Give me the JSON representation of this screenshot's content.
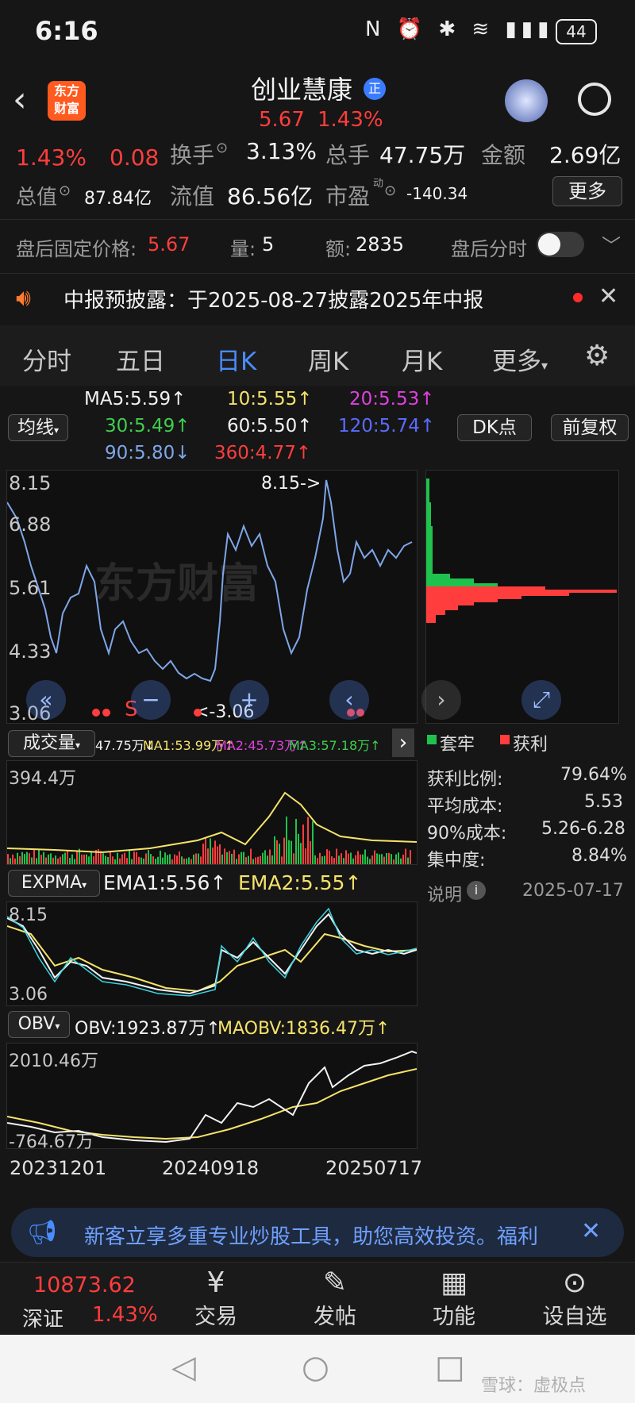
{
  "status_bar": {
    "time": "6:16",
    "battery": "44"
  },
  "header": {
    "title": "创业慧康",
    "badge": "正",
    "price": "5.67",
    "change_pct": "1.43%",
    "logo_line1": "东方",
    "logo_line2": "财富"
  },
  "quote": {
    "row1": {
      "pct": "1.43%",
      "chg": "0.08",
      "turnover_label": "换手",
      "turnover": "3.13%",
      "volume_label": "总手",
      "volume": "47.75万",
      "amount_label": "金额",
      "amount": "2.69亿"
    },
    "row2": {
      "mktcap_label": "总值",
      "mktcap": "87.84亿",
      "float_label": "流值",
      "float": "86.56亿",
      "pe_label": "市盈",
      "pe_sup": "动",
      "pe": "-140.34",
      "more": "更多"
    },
    "row3": {
      "fixed_label": "盘后固定价格:",
      "fixed": "5.67",
      "qty_label": "量:",
      "qty": "5",
      "amt_label": "额:",
      "amt": "2835",
      "toggle_label": "盘后分时"
    }
  },
  "notice": {
    "text": "中报预披露：于2025-08-27披露2025年中报"
  },
  "tabs": [
    "分时",
    "五日",
    "日K",
    "周K",
    "月K",
    "更多"
  ],
  "ma": {
    "selector": "均线",
    "ma5": "MA5:5.59↑",
    "ma10": "10:5.55↑",
    "ma20": "20:5.53↑",
    "ma30": "30:5.49↑",
    "ma60": "60:5.50↑",
    "ma120": "120:5.74↑",
    "ma90": "90:5.80↓",
    "ma360": "360:4.77↑",
    "dk_btn": "DK点",
    "fq_btn": "前复权"
  },
  "price_axis": [
    "8.15",
    "6.88",
    "5.61",
    "4.33",
    "3.06"
  ],
  "price_annot": {
    "high": "8.15->",
    "low": "<-3.06",
    "sell": "S",
    "watermark": "东方财富"
  },
  "chip": {
    "legend_trapped": "套牢",
    "legend_profit": "获利",
    "profit_ratio_label": "获利比例:",
    "profit_ratio": "79.64%",
    "avg_cost_label": "平均成本:",
    "avg_cost": "5.53",
    "cost90_label": "90%成本:",
    "cost90": "5.26-6.28",
    "concentration_label": "集中度:",
    "concentration": "8.84%",
    "explain": "说明",
    "date": "2025-07-17"
  },
  "volume": {
    "selector": "成交量",
    "vol": "47.75万↓",
    "ma1": "MA1:53.99万↑",
    "ma2": "MA2:45.73万↑",
    "ma3": "MA3:57.18万↑",
    "axis_top": "394.4万"
  },
  "expma": {
    "selector": "EXPMA",
    "ema1": "EMA1:5.56↑",
    "ema2": "EMA2:5.55↑",
    "axis_top": "8.15",
    "axis_bottom": "3.06"
  },
  "obv": {
    "selector": "OBV",
    "obv": "OBV:1923.87万↑",
    "maobv": "MAOBV:1836.47万↑",
    "axis_top": "2010.46万",
    "axis_bottom": "-764.67万"
  },
  "dates": [
    "20231201",
    "20240918",
    "20250717"
  ],
  "banner": {
    "text": "新客立享多重专业炒股工具，助您高效投资。福利"
  },
  "bottom_nav": {
    "index_value": "10873.62",
    "index_name": "深证",
    "index_pct": "1.43%",
    "trade": "交易",
    "post": "发帖",
    "func": "功能",
    "watch": "设自选"
  },
  "footer": {
    "watermark": "雪球：虚极点"
  },
  "colors": {
    "up": "#ff3d3d",
    "down": "#1fc24c",
    "accent": "#4a8cff",
    "price_line": "#7ea6e8",
    "ema_yellow": "#f5e36a"
  }
}
